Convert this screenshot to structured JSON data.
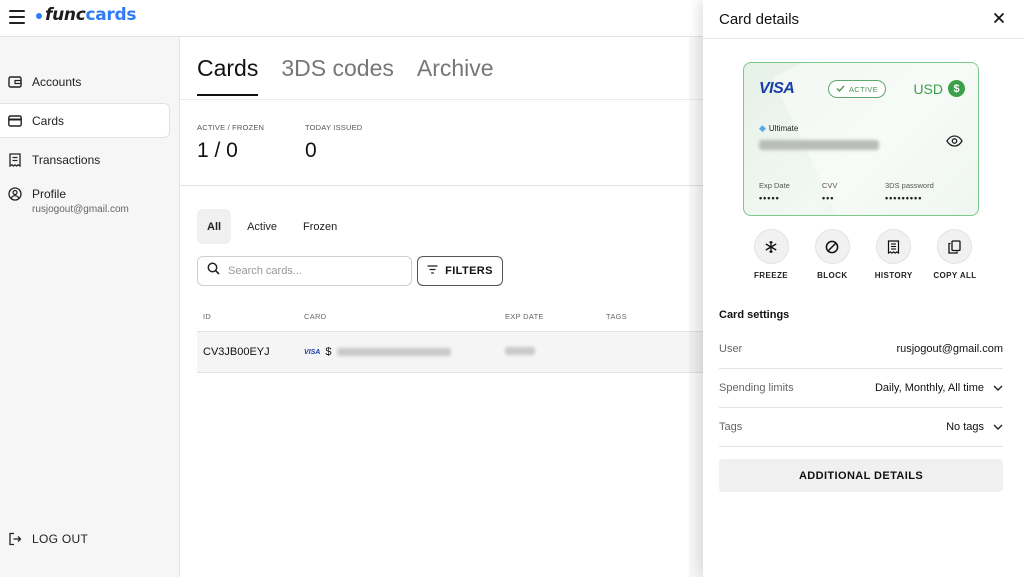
{
  "app": {
    "logo_text": "func",
    "logo_accent": "cards",
    "brand_color": "#2f7cf6"
  },
  "sidebar": {
    "items": [
      {
        "label": "Accounts",
        "icon": "wallet-icon"
      },
      {
        "label": "Cards",
        "icon": "credit-card-icon",
        "active": true
      },
      {
        "label": "Transactions",
        "icon": "receipt-icon"
      },
      {
        "label": "Profile",
        "icon": "user-circle-icon",
        "sub": "rusjogout@gmail.com"
      }
    ],
    "logout_label": "LOG OUT"
  },
  "main": {
    "tabs": [
      {
        "label": "Cards",
        "active": true
      },
      {
        "label": "3DS codes"
      },
      {
        "label": "Archive"
      }
    ],
    "stats": [
      {
        "label": "ACTIVE / FROZEN",
        "value": "1 / 0"
      },
      {
        "label": "TODAY ISSUED",
        "value": "0"
      }
    ],
    "filter_pills": [
      {
        "label": "All",
        "active": true
      },
      {
        "label": "Active"
      },
      {
        "label": "Frozen"
      }
    ],
    "search": {
      "placeholder": "Search cards...",
      "value": ""
    },
    "filters_label": "FILTERS",
    "table": {
      "columns": [
        "ID",
        "CARD",
        "EXP DATE",
        "TAGS"
      ],
      "rows": [
        {
          "id": "CV3JB00EYJ",
          "brand": "VISA",
          "currency_symbol": "$",
          "card_number": "(blurred)",
          "exp_date": "(blurred)",
          "tags": ""
        }
      ]
    }
  },
  "drawer": {
    "title": "Card details",
    "card": {
      "brand": "VISA",
      "status": "ACTIVE",
      "currency": "USD",
      "currency_symbol": "$",
      "tier": "Ultimate",
      "fields": [
        {
          "label": "Exp Date",
          "value": "•••••"
        },
        {
          "label": "CVV",
          "value": "•••"
        },
        {
          "label": "3DS password",
          "value": "•••••••••"
        }
      ],
      "accent_color": "#3aa14a"
    },
    "actions": [
      {
        "label": "FREEZE",
        "icon": "snowflake-icon"
      },
      {
        "label": "BLOCK",
        "icon": "block-icon"
      },
      {
        "label": "HISTORY",
        "icon": "history-icon"
      },
      {
        "label": "COPY ALL",
        "icon": "copy-icon"
      }
    ],
    "settings_title": "Card settings",
    "settings": [
      {
        "key": "User",
        "value": "rusjogout@gmail.com"
      },
      {
        "key": "Spending limits",
        "value": "Daily, Monthly, All time"
      },
      {
        "key": "Tags",
        "value": "No tags"
      }
    ],
    "additional_label": "ADDITIONAL DETAILS"
  }
}
